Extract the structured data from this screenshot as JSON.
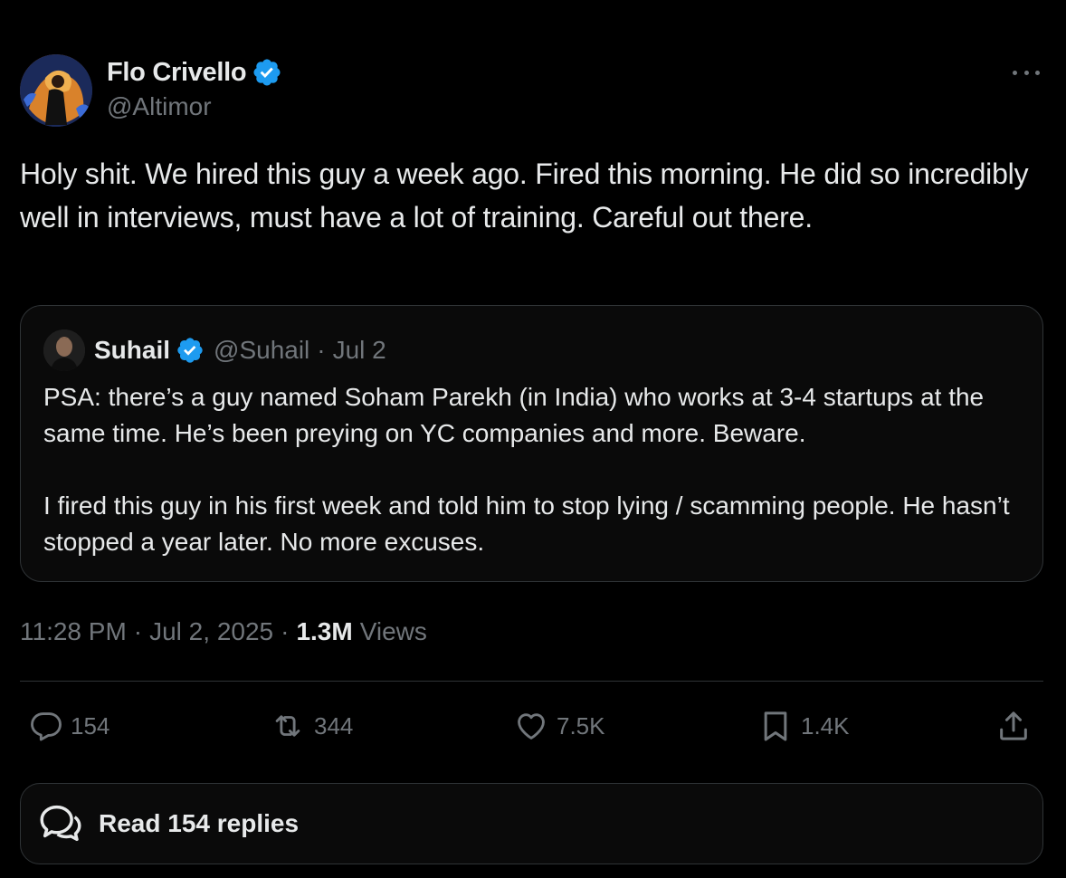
{
  "author": {
    "display_name": "Flo Crivello",
    "handle": "@Altimor",
    "verified_icon": "verified-badge-icon",
    "avatar": "avatar"
  },
  "more_icon": "more-options-icon",
  "tweet_text": "Holy shit. We hired this guy a week ago. Fired this morning. He did so incredibly well in interviews, must have a lot of training. Careful out there.",
  "quote": {
    "display_name": "Suhail",
    "handle": "@Suhail",
    "separator": "·",
    "date": "Jul 2",
    "paragraphs": [
      "PSA: there’s a guy named Soham Parekh (in India) who works at 3-4 startups at the same time. He’s been preying on YC companies and more. Beware.",
      "I fired this guy in his first week and told him to stop lying / scamming people. He hasn’t stopped a year later. No more excuses."
    ]
  },
  "meta": {
    "time": "11:28 PM",
    "separator": "·",
    "date": "Jul 2, 2025",
    "views_count": "1.3M",
    "views_label": "Views"
  },
  "actions": {
    "replies": "154",
    "reposts": "344",
    "likes": "7.5K",
    "bookmarks": "1.4K"
  },
  "read_replies_label": "Read 154 replies",
  "colors": {
    "background": "#000000",
    "text_primary": "#e7e9ea",
    "text_secondary": "#71767b",
    "border": "#2f3336",
    "verified_blue": "#1d9bf0"
  }
}
